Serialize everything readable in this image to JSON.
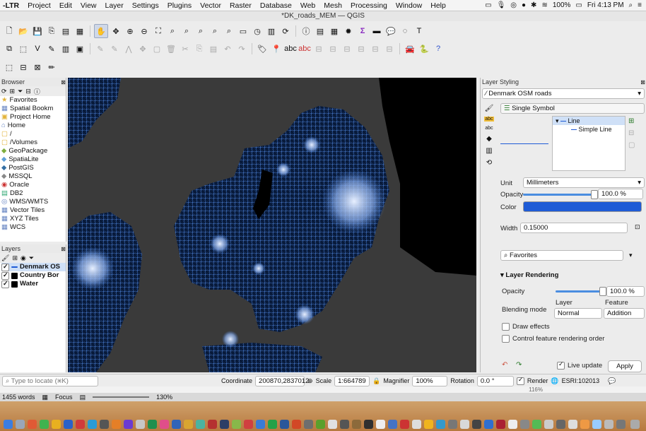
{
  "menubar": {
    "app": "-LTR",
    "items": [
      "Project",
      "Edit",
      "View",
      "Layer",
      "Settings",
      "Plugins",
      "Vector",
      "Raster",
      "Database",
      "Web",
      "Mesh",
      "Processing",
      "Window",
      "Help"
    ],
    "battery": "100%",
    "clock": "Fri 4:13 PM"
  },
  "window_title": "*DK_roads_MEM — QGIS",
  "browser": {
    "title": "Browser",
    "items": [
      "Favorites",
      "Spatial Bookm",
      "Project Home",
      "Home",
      "/",
      "/Volumes",
      "GeoPackage",
      "SpatiaLite",
      "PostGIS",
      "MSSQL",
      "Oracle",
      "DB2",
      "WMS/WMTS",
      "Vector Tiles",
      "XYZ Tiles",
      "WCS"
    ]
  },
  "layers": {
    "title": "Layers",
    "items": [
      {
        "name": "Denmark OS",
        "checked": true,
        "color": "#1e5bd6"
      },
      {
        "name": "Country Bor",
        "checked": true,
        "color": "#000000"
      },
      {
        "name": "Water",
        "checked": true,
        "color": "#000000"
      }
    ]
  },
  "styling": {
    "title": "Layer Styling",
    "layer": "Denmark OSM roads",
    "renderer": "Single Symbol",
    "tree_line": "Line",
    "tree_simple_line": "Simple Line",
    "unit_label": "Unit",
    "unit_value": "Millimeters",
    "opacity_label": "Opacity",
    "opacity_value": "100.0 %",
    "color_label": "Color",
    "color_value": "#1e5bd6",
    "width_label": "Width",
    "width_value": "0.15000",
    "favorites": "Favorites",
    "layer_rendering": "Layer Rendering",
    "lr_opacity_label": "Opacity",
    "lr_opacity_value": "100.0 %",
    "blending_label": "Blending mode",
    "blend_layer_label": "Layer",
    "blend_feature_label": "Feature",
    "blend_layer_value": "Normal",
    "blend_feature_value": "Addition",
    "draw_effects": "Draw effects",
    "control_order": "Control feature rendering order",
    "live_update": "Live update",
    "apply": "Apply"
  },
  "statusbar": {
    "locate_placeholder": "Type to locate (⌘K)",
    "coordinate_label": "Coordinate",
    "coordinate_value": "200870,2837012",
    "scale_label": "Scale",
    "scale_value": "1:664789",
    "magnifier_label": "Magnifier",
    "magnifier_value": "100%",
    "rotation_label": "Rotation",
    "rotation_value": "0.0 °",
    "render_label": "Render",
    "crs": "ESRI:102013"
  },
  "wordbar": {
    "words": "1455 words",
    "focus": "Focus",
    "zoom": "130%",
    "right_zoom": "116%"
  }
}
